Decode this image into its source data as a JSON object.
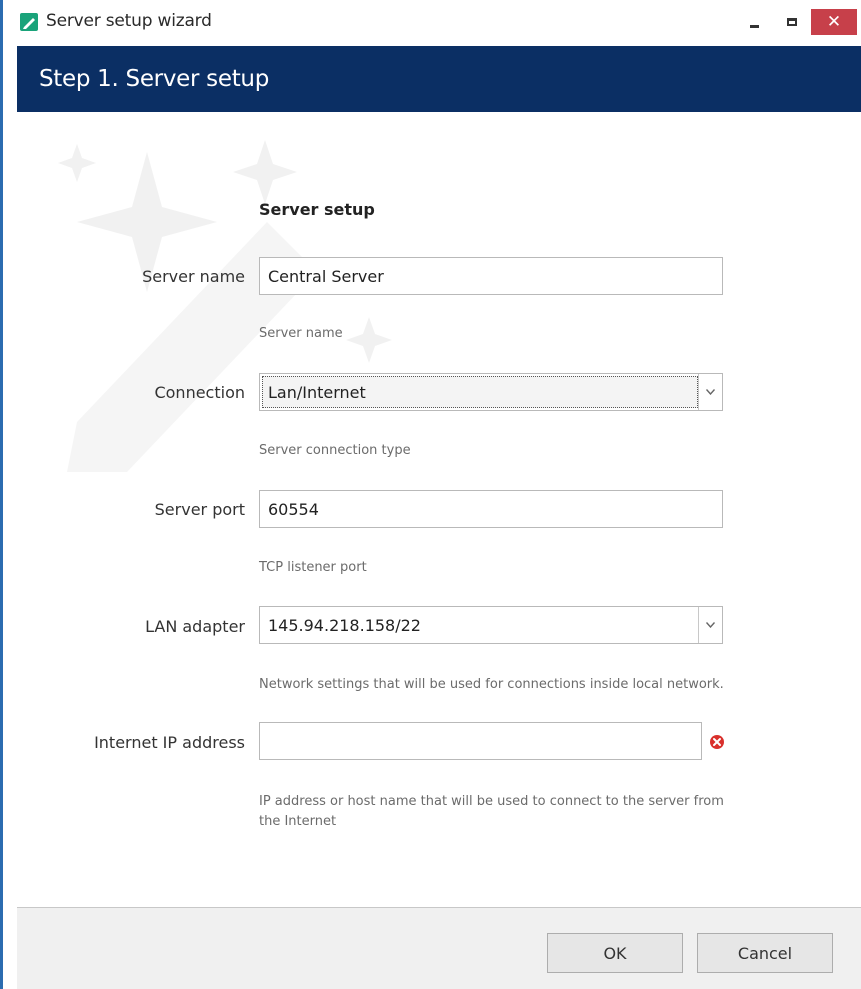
{
  "window": {
    "title": "Server setup wizard",
    "close_glyph": "✕"
  },
  "header": {
    "title": "Step 1. Server setup"
  },
  "form": {
    "section_title": "Server setup",
    "server_name": {
      "label": "Server name",
      "value": "Central Server",
      "hint": "Server name"
    },
    "connection": {
      "label": "Connection",
      "value": "Lan/Internet",
      "hint": "Server connection type"
    },
    "server_port": {
      "label": "Server port",
      "value": "60554",
      "hint": "TCP listener port"
    },
    "lan_adapter": {
      "label": "LAN adapter",
      "value": "145.94.218.158/22",
      "hint": "Network settings that will be used for connections inside local network."
    },
    "internet_ip": {
      "label": "Internet IP address",
      "value": "",
      "hint_line1": "IP address or host name that will be used to connect to the server from",
      "hint_line2": "the Internet"
    }
  },
  "footer": {
    "ok_label": "OK",
    "cancel_label": "Cancel"
  },
  "icons": {
    "app": "app-icon",
    "error": "error-icon",
    "dropdown": "chevron-down-icon"
  },
  "colors": {
    "header_bg": "#0b2f64",
    "close_bg": "#c7404a",
    "error": "#d9302c",
    "app_icon": "#1aa37a"
  }
}
